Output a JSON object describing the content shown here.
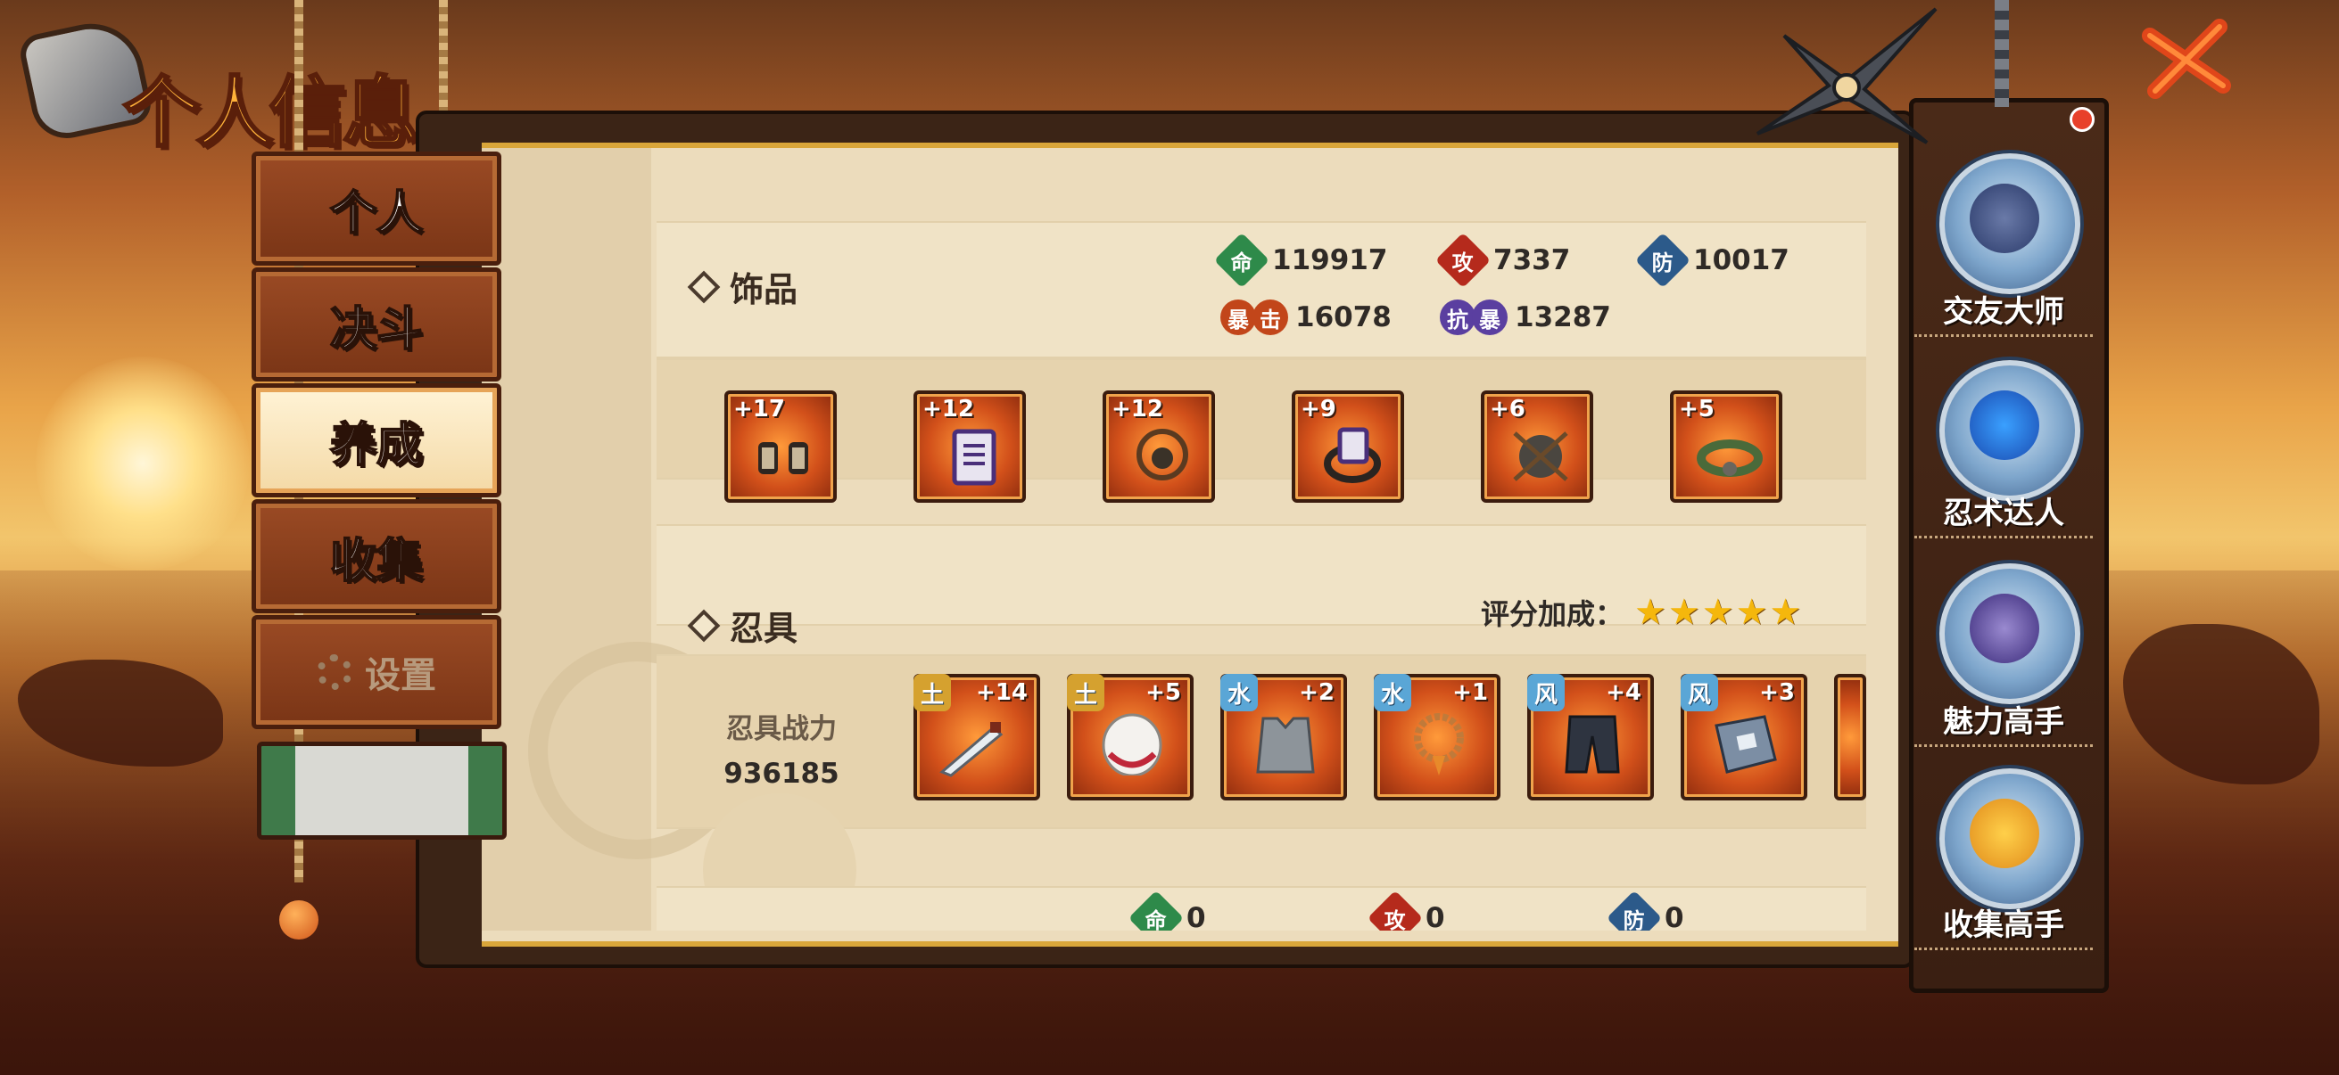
{
  "header": {
    "title": "个人信息"
  },
  "tabs": [
    {
      "label": "个人"
    },
    {
      "label": "决斗"
    },
    {
      "label": "养成"
    },
    {
      "label": "收集"
    },
    {
      "label": "设置"
    }
  ],
  "accessories": {
    "title": "饰品",
    "stats": {
      "hp": {
        "icon": "命",
        "value": "119917"
      },
      "atk": {
        "icon": "攻",
        "value": "7337"
      },
      "def": {
        "icon": "防",
        "value": "10017"
      },
      "crit": {
        "icon1": "暴",
        "icon2": "击",
        "value": "16078"
      },
      "crit_res": {
        "icon1": "抗",
        "icon2": "暴",
        "value": "13287"
      }
    },
    "items": [
      {
        "level": "+17"
      },
      {
        "level": "+12"
      },
      {
        "level": "+12"
      },
      {
        "level": "+9"
      },
      {
        "level": "+6"
      },
      {
        "level": "+5"
      }
    ]
  },
  "ninja_tools": {
    "title": "忍具",
    "rating_label": "评分加成：",
    "stars": 5,
    "power_label": "忍具战力",
    "power_value": "936185",
    "items": [
      {
        "element": "土",
        "level": "+14"
      },
      {
        "element": "土",
        "level": "+5"
      },
      {
        "element": "水",
        "level": "+2"
      },
      {
        "element": "水",
        "level": "+1"
      },
      {
        "element": "风",
        "level": "+4"
      },
      {
        "element": "风",
        "level": "+3"
      }
    ]
  },
  "third_section": {
    "stats": {
      "hp": {
        "icon": "命",
        "value": "0"
      },
      "atk": {
        "icon": "攻",
        "value": "0"
      },
      "def": {
        "icon": "防",
        "value": "0"
      }
    }
  },
  "achievements": [
    {
      "label": "交友大师"
    },
    {
      "label": "忍术达人"
    },
    {
      "label": "魅力高手"
    },
    {
      "label": "收集高手"
    }
  ],
  "colors": {
    "hp": "#2e8a4a",
    "atk": "#b52a1c",
    "def": "#2c5a8a",
    "crit": "#c2461a",
    "crit_res": "#5a3fa0"
  }
}
